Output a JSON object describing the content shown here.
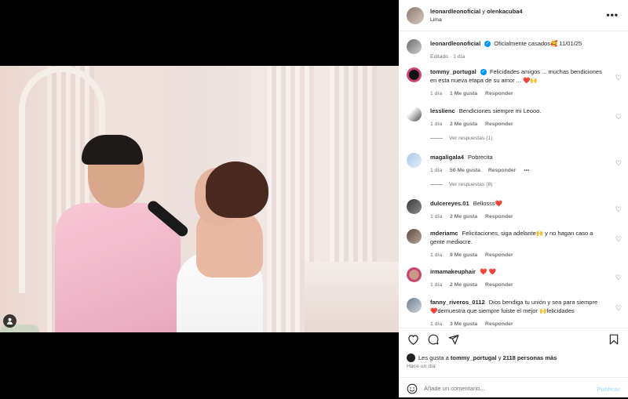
{
  "header": {
    "user1": "leonardleonoficial",
    "connector": "y",
    "user2": "olenkacuba4",
    "location": "Lima",
    "more_label": "•••"
  },
  "caption": {
    "user": "leonardleonoficial",
    "text": "Oficialmente casados🥰 11/01/25",
    "meta": "Editado · 1 día"
  },
  "comments": [
    {
      "user": "tommy_portugal",
      "verified": true,
      "text": "Felicidades amigos ... muchas bendiciones en esta nueva etapa de su amor ... ❤️🙌",
      "time": "1 día",
      "likes": "1 Me gusta",
      "reply": "Responder"
    },
    {
      "user": "lesslienc",
      "verified": false,
      "text": "Bendiciones siempre mi Leooo.",
      "time": "1 día",
      "likes": "2 Me gusta",
      "reply": "Responder",
      "view_replies": "Ver respuestas (1)"
    },
    {
      "user": "magaligala4",
      "verified": false,
      "text": "Pobrecita",
      "time": "1 día",
      "likes": "50 Me gusta",
      "reply": "Responder",
      "more": "•••",
      "view_replies": "Ver respuestas (8)"
    },
    {
      "user": "dulcereyes.01",
      "verified": false,
      "text": "Bellosss❤️",
      "time": "1 día",
      "likes": "2 Me gusta",
      "reply": "Responder"
    },
    {
      "user": "mderiamc",
      "verified": false,
      "text": "Felicitaciones, siga adelante🙌 y no hagan caso a gente mediocre.",
      "time": "1 día",
      "likes": "9 Me gusta",
      "reply": "Responder"
    },
    {
      "user": "irmamakeuphair",
      "verified": false,
      "text": "❤️ ❤️",
      "time": "1 día",
      "likes": "2 Me gusta",
      "reply": "Responder"
    },
    {
      "user": "fanny_riveros_0112",
      "verified": false,
      "text": "Dios bendiga tu unión y sea para siempre ❤️demuestra que siempre fuiste el mejor 🙌felicidades",
      "time": "1 día",
      "likes": "3 Me gusta",
      "reply": "Responder"
    }
  ],
  "likes": {
    "prefix": "Les gusta a",
    "user": "tommy_portugal",
    "connector": "y",
    "others": "2118 personas más"
  },
  "post_time": "Hace un día",
  "add_comment": {
    "placeholder": "Añade un comentario...",
    "publish": "Publicar"
  },
  "colors": {
    "verified": "#0095f6",
    "heart": "#ed4956",
    "publish_disabled": "#b2dffc"
  }
}
